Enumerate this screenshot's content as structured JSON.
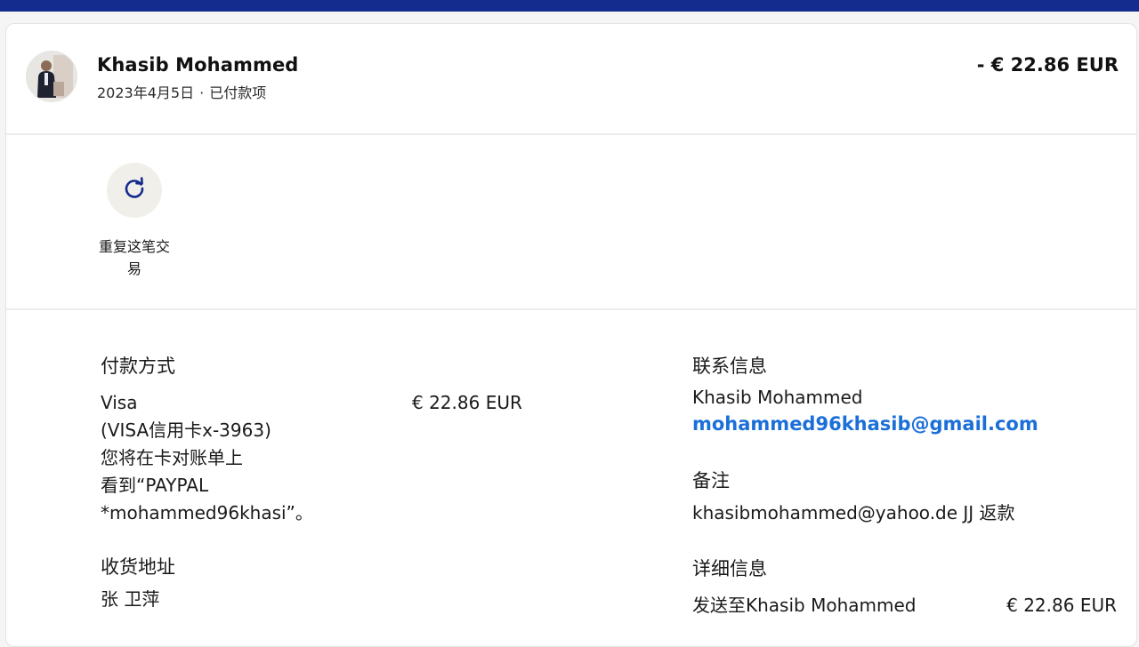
{
  "header": {
    "name": "Khasib Mohammed",
    "date": "2023年4月5日",
    "separator": "·",
    "status": "已付款项",
    "amount": "- € 22.86 EUR"
  },
  "actions": {
    "repeat_label": "重复这笔交易"
  },
  "payment_method": {
    "title": "付款方式",
    "lines": [
      "Visa",
      "(VISA信用卡x-3963)",
      "您将在卡对账单上",
      "看到“PAYPAL",
      "*mohammed96khasi”。"
    ],
    "amount": "€ 22.86 EUR"
  },
  "shipping": {
    "title": "收货地址",
    "name": "张 卫萍"
  },
  "contact": {
    "title": "联系信息",
    "name": "Khasib Mohammed",
    "email": "mohammed96khasib@gmail.com"
  },
  "note": {
    "title": "备注",
    "text": "khasibmohammed@yahoo.de JJ 返款"
  },
  "details": {
    "title": "详细信息",
    "sent_to": "发送至Khasib Mohammed",
    "amount": "€ 22.86 EUR"
  },
  "colors": {
    "top_bar": "#142c8e",
    "link": "#1b6fd8",
    "icon": "#142c8e"
  },
  "icons": {
    "repeat": "refresh-icon"
  }
}
